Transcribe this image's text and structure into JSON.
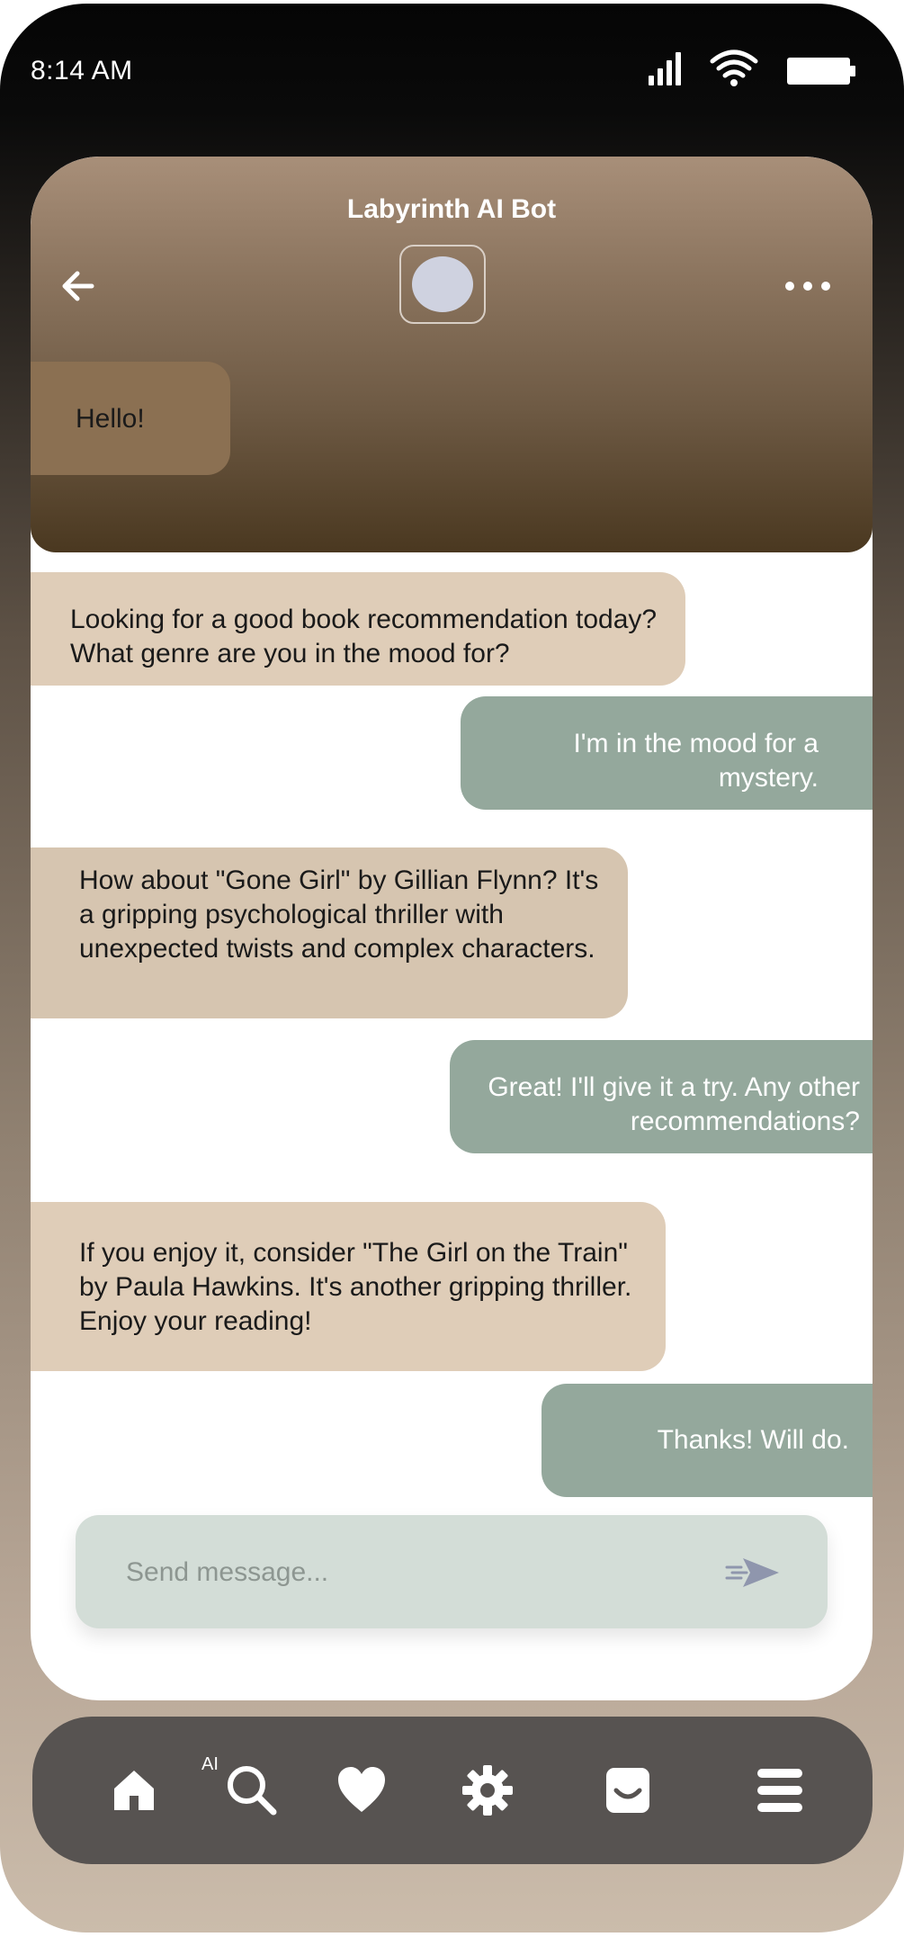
{
  "status_bar": {
    "time": "8:14 AM",
    "icons": [
      "signal-icon",
      "wifi-icon",
      "battery-icon"
    ]
  },
  "chat": {
    "title": "Labyrinth AI Bot",
    "back_icon": "arrow-left-icon",
    "more_icon": "more-horizontal-icon",
    "messages": [
      {
        "sender": "bot",
        "text": "Hello!"
      },
      {
        "sender": "bot",
        "text": "Looking for a good book recommendation today? What genre are you in the mood for?"
      },
      {
        "sender": "user",
        "text": "I'm in the mood for a mystery."
      },
      {
        "sender": "bot",
        "text": "How about \"Gone Girl\" by Gillian Flynn? It's a gripping psychological thriller with unexpected twists and complex characters."
      },
      {
        "sender": "user",
        "text": "Great! I'll give it a try. Any other recommendations?"
      },
      {
        "sender": "bot",
        "text": "If you enjoy it, consider \"The Girl on the Train\" by Paula Hawkins. It's another gripping thriller. Enjoy your reading!"
      },
      {
        "sender": "user",
        "text": "Thanks! Will do."
      }
    ]
  },
  "composer": {
    "placeholder": "Send message...",
    "value": "",
    "send_icon": "send-icon"
  },
  "nav": {
    "ai_label": "AI",
    "items": [
      "home-icon",
      "ai-search-icon",
      "heart-icon",
      "gear-icon",
      "profile-icon",
      "menu-icon"
    ]
  },
  "colors": {
    "bot_bubble": "#dfcdb8",
    "user_bubble": "#94a89c",
    "header_top": "#a88f79",
    "header_bottom": "#4a3820",
    "composer_bg": "#d3ddd7",
    "nav_bg": "#575351"
  }
}
